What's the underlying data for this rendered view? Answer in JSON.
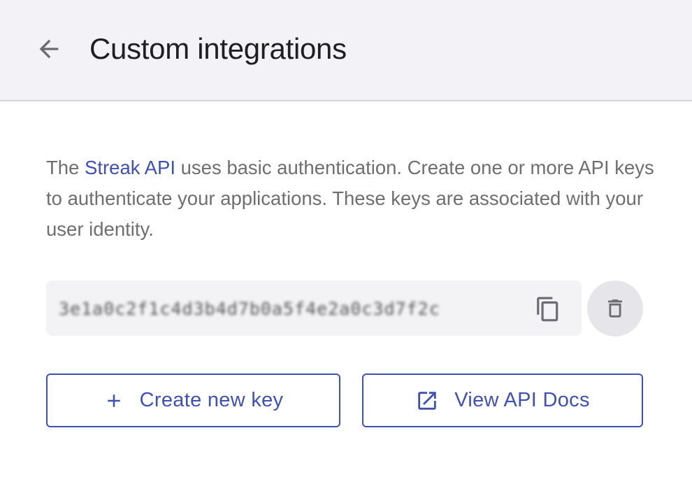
{
  "header": {
    "title": "Custom integrations",
    "back_icon": "arrow-left-icon"
  },
  "description": {
    "prefix": "The ",
    "link_text": "Streak API",
    "suffix": " uses basic authentication. Create one or more API keys to authenticate your applications. These keys are associated with your user identity."
  },
  "api_key": {
    "value": "3e1a0c2f1c4d3b4d7b0a5f4e2a0c3d7f2c",
    "copy_icon": "copy-icon",
    "delete_icon": "trash-icon"
  },
  "actions": {
    "create_label": "Create new key",
    "create_icon": "plus-icon",
    "docs_label": "View API Docs",
    "docs_icon": "open-in-new-icon"
  },
  "colors": {
    "accent": "#3f51b5",
    "header_bg": "#f3f2f6",
    "body_text": "#6e6e73",
    "title_text": "#1f1f1f"
  }
}
